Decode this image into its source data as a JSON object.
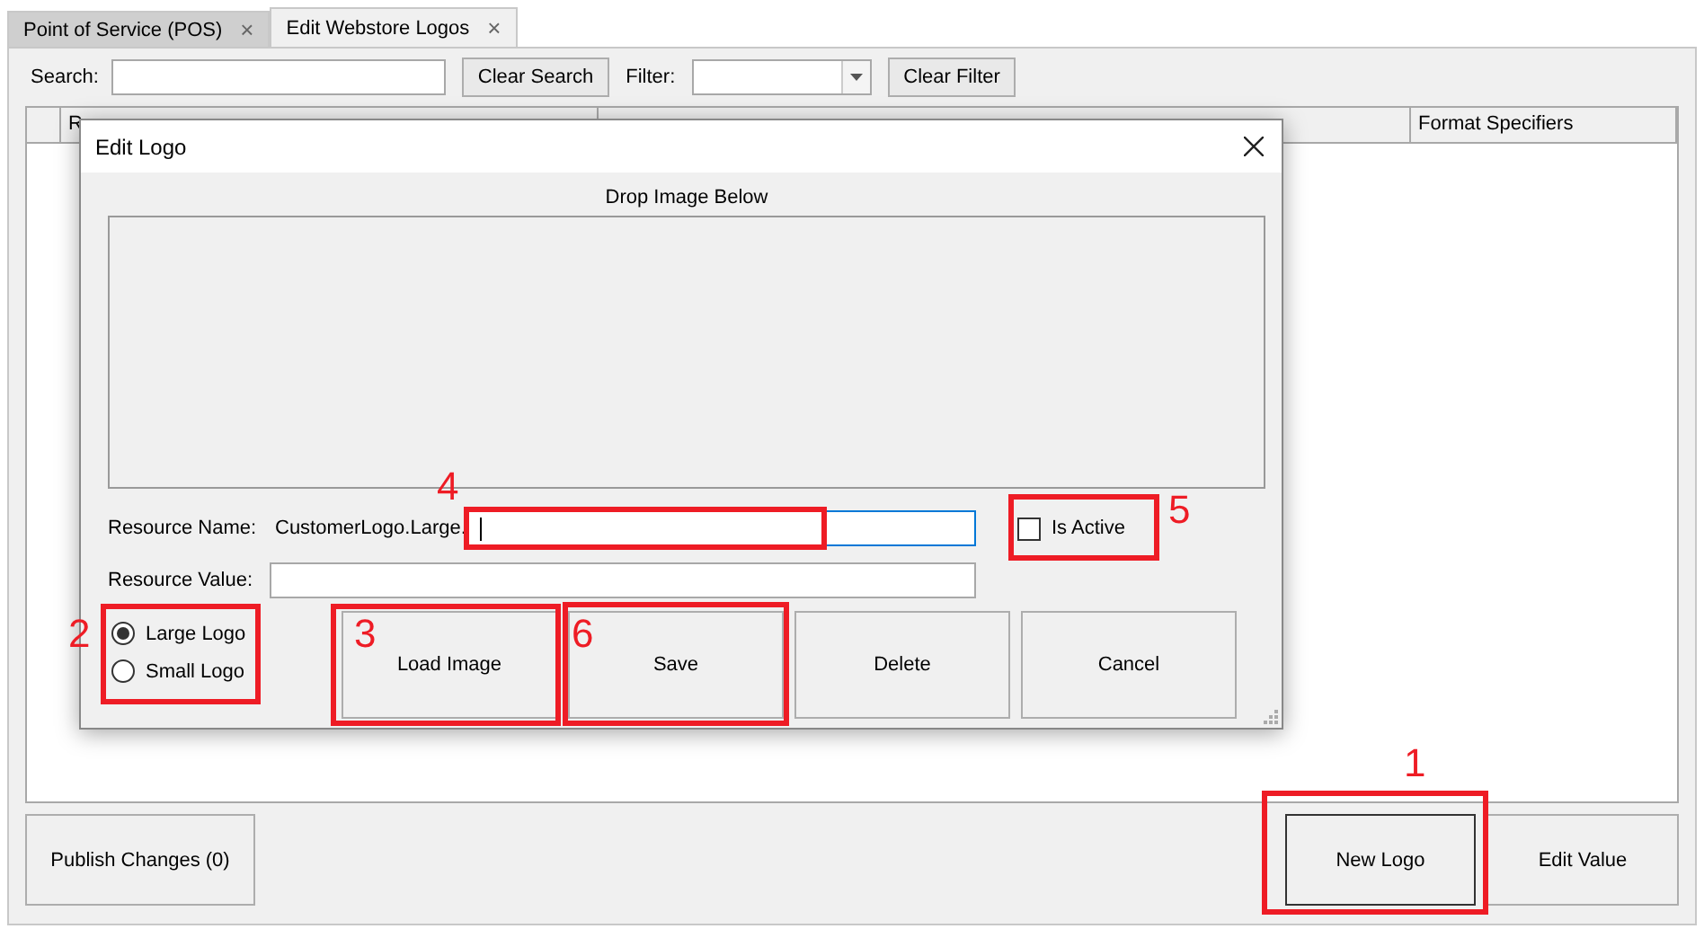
{
  "tabs": [
    {
      "label": "Point of Service (POS)",
      "selected": false,
      "close": "×"
    },
    {
      "label": "Edit Webstore Logos",
      "selected": true,
      "close": "×"
    }
  ],
  "toolbar": {
    "search_label": "Search:",
    "clear_search": "Clear Search",
    "filter_label": "Filter:",
    "clear_filter": "Clear Filter"
  },
  "table": {
    "columns": [
      {
        "label": "R"
      },
      {
        "label": "Format Specifiers"
      }
    ]
  },
  "footer": {
    "publish": "Publish Changes (0)",
    "new_logo": "New Logo",
    "edit_value": "Edit Value"
  },
  "dialog": {
    "title": "Edit Logo",
    "drop_label": "Drop Image Below",
    "resource_name_label": "Resource Name:",
    "resource_prefix": "CustomerLogo.Large.",
    "resource_value_label": "Resource Value:",
    "is_active": {
      "label": "Is Active",
      "checked": false
    },
    "logo_sizes": [
      {
        "label": "Large Logo",
        "selected": true
      },
      {
        "label": "Small Logo",
        "selected": false
      }
    ],
    "buttons": [
      "Load Image",
      "Save",
      "Delete",
      "Cancel"
    ]
  },
  "annotations": [
    {
      "number": "1"
    },
    {
      "number": "2"
    },
    {
      "number": "3"
    },
    {
      "number": "4"
    },
    {
      "number": "5"
    },
    {
      "number": "6"
    }
  ]
}
